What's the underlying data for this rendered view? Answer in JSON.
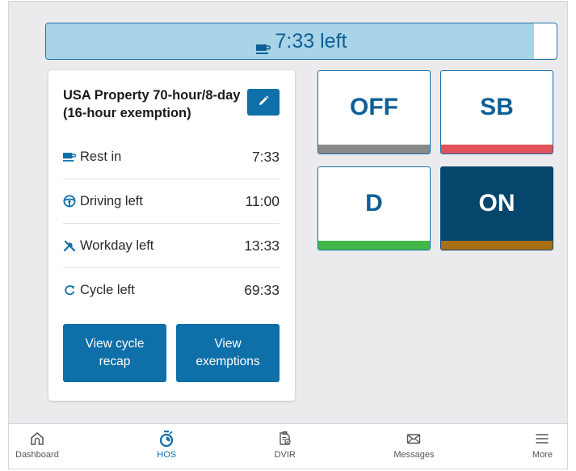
{
  "timer": {
    "text": "7:33 left",
    "fill_fraction": 0.955,
    "fill_color": "#a9d3e6",
    "accent_color": "#1f6fa8"
  },
  "hos_card": {
    "ruleset": "USA Property 70-hour/8-day (16-hour exemption)",
    "edit_icon": "pencil-icon",
    "stats": [
      {
        "label": "Rest in",
        "value": "7:33",
        "icon": "coffee-cup-icon"
      },
      {
        "label": "Driving left",
        "value": "11:00",
        "icon": "steering-wheel-icon"
      },
      {
        "label": "Workday left",
        "value": "13:33",
        "icon": "tools-icon"
      },
      {
        "label": "Cycle left",
        "value": "69:33",
        "icon": "cycle-icon"
      }
    ],
    "buttons": {
      "cycle_recap": "View cycle recap",
      "exemptions": "View exemptions"
    }
  },
  "status_buttons": [
    {
      "label": "OFF",
      "stripe_color": "#8a8a8a",
      "active": false
    },
    {
      "label": "SB",
      "stripe_color": "#e2525a",
      "active": false
    },
    {
      "label": "D",
      "stripe_color": "#43b748",
      "active": false
    },
    {
      "label": "ON",
      "stripe_color": "#a86f14",
      "active": true
    }
  ],
  "bottom_nav": [
    {
      "label": "Dashboard",
      "icon": "home-icon",
      "active": false
    },
    {
      "label": "HOS",
      "icon": "stopwatch-icon",
      "active": true
    },
    {
      "label": "DVIR",
      "icon": "inspection-icon",
      "active": false
    },
    {
      "label": "Messages",
      "icon": "envelope-icon",
      "active": false
    },
    {
      "label": "More",
      "icon": "menu-icon",
      "active": false
    }
  ],
  "colors": {
    "primary": "#0e6fa9",
    "on_duty_active": "#05466d",
    "background": "#ebebee"
  }
}
